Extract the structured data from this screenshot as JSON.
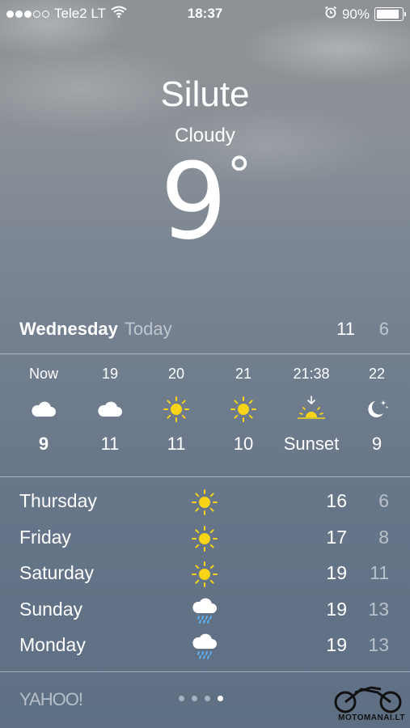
{
  "status_bar": {
    "carrier": "Tele2 LT",
    "time": "18:37",
    "battery": "90%",
    "battery_level": 0.9,
    "signal_bars_filled": 3,
    "signal_bars_total": 5
  },
  "location": {
    "city": "Silute",
    "condition": "Cloudy",
    "temperature": "9",
    "degree_symbol": "°"
  },
  "today": {
    "day": "Wednesday",
    "label": "Today",
    "high": "11",
    "low": "6"
  },
  "hourly": [
    {
      "time": "Now",
      "icon": "cloud-icon",
      "value": "9",
      "bold": true
    },
    {
      "time": "19",
      "icon": "cloud-icon",
      "value": "11"
    },
    {
      "time": "20",
      "icon": "sun-icon",
      "value": "11"
    },
    {
      "time": "21",
      "icon": "sun-icon",
      "value": "10"
    },
    {
      "time": "21:38",
      "icon": "sunset-icon",
      "value": "Sunset"
    },
    {
      "time": "22",
      "icon": "moon-icon",
      "value": "9"
    }
  ],
  "daily": [
    {
      "day": "Thursday",
      "icon": "sun-icon",
      "high": "16",
      "low": "6"
    },
    {
      "day": "Friday",
      "icon": "sun-icon",
      "high": "17",
      "low": "8"
    },
    {
      "day": "Saturday",
      "icon": "sun-icon",
      "high": "19",
      "low": "11"
    },
    {
      "day": "Sunday",
      "icon": "rain-cloud-icon",
      "high": "19",
      "low": "13"
    },
    {
      "day": "Monday",
      "icon": "rain-cloud-icon",
      "high": "19",
      "low": "13"
    }
  ],
  "footer": {
    "provider": "YAHOO!",
    "pages_total": 4,
    "active_page": 4,
    "watermark": "MOTOMANAI.LT"
  },
  "colors": {
    "sun": "#f7d417",
    "text": "#ffffff",
    "muted": "rgba(255,255,255,0.55)"
  }
}
